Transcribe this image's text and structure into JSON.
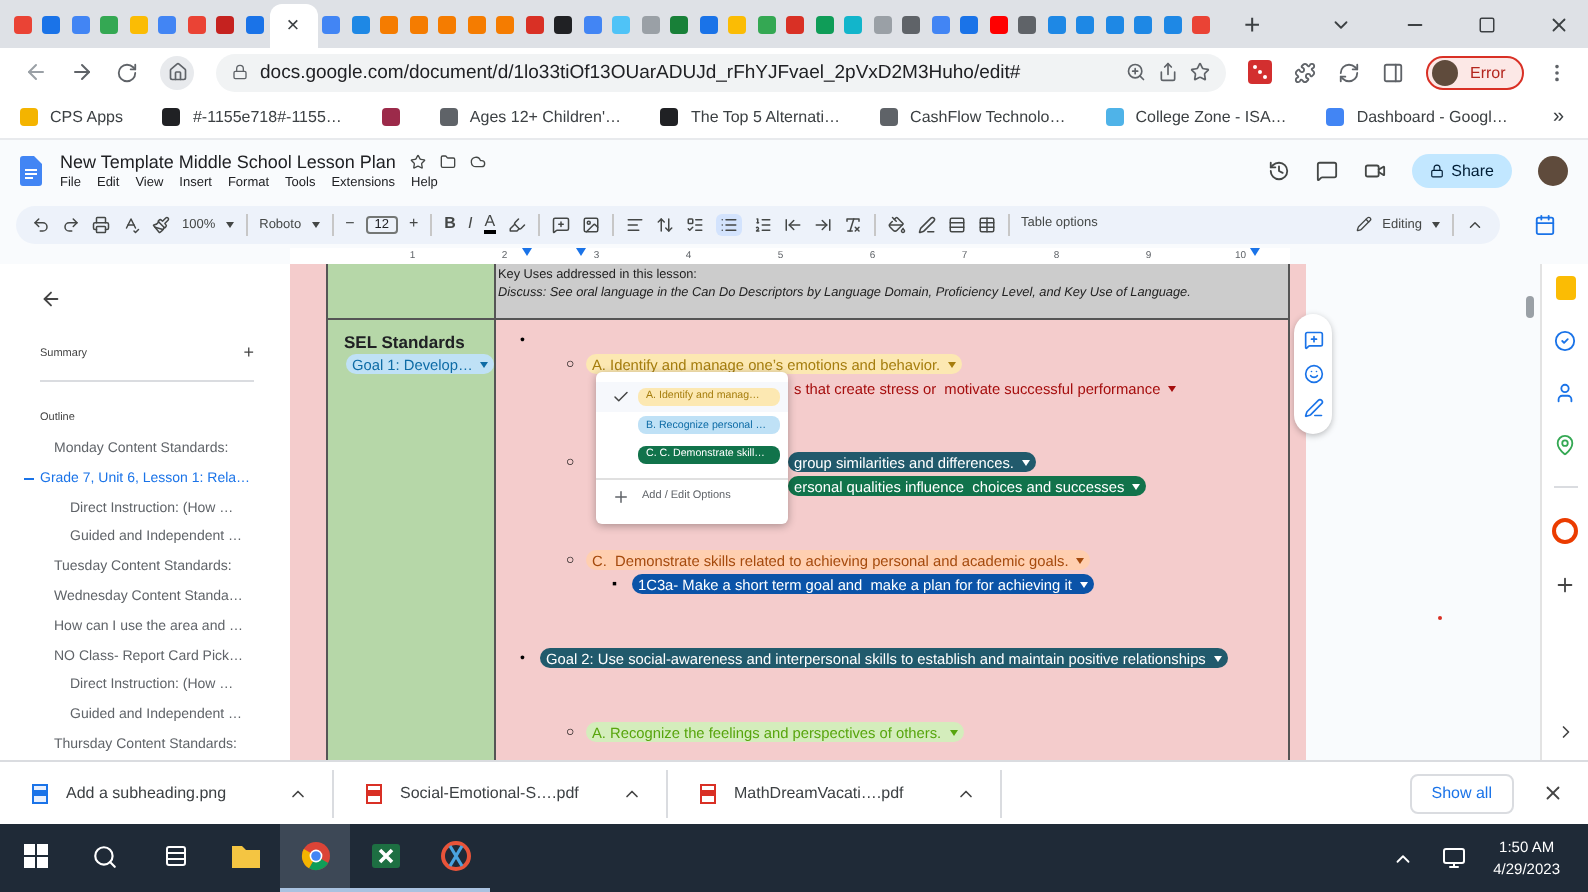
{
  "browser": {
    "tabs": [
      {
        "color": "#ea4335",
        "selected": false
      },
      {
        "color": "#1a73e8",
        "selected": false
      },
      {
        "color": "#4285f4",
        "selected": false
      },
      {
        "color": "#34a853",
        "selected": false
      },
      {
        "color": "#fbbc04",
        "selected": false
      },
      {
        "color": "#4285f4",
        "selected": false
      },
      {
        "color": "#ea4335",
        "selected": false
      },
      {
        "color": "#c5221f",
        "selected": false
      },
      {
        "color": "#1a73e8",
        "selected": false
      },
      {
        "selected": true
      },
      {
        "color": "#4285f4",
        "selected": false
      },
      {
        "color": "#1e88e5",
        "selected": false
      },
      {
        "color": "#f57c00",
        "selected": false
      },
      {
        "color": "#f57c00",
        "selected": false
      },
      {
        "color": "#f57c00",
        "selected": false
      },
      {
        "color": "#f57c00",
        "selected": false
      },
      {
        "color": "#f57c00",
        "selected": false
      },
      {
        "color": "#d93025",
        "selected": false
      },
      {
        "color": "#202124",
        "selected": false
      },
      {
        "color": "#4285f4",
        "selected": false
      },
      {
        "color": "#4fc3f7",
        "selected": false
      },
      {
        "color": "#9aa0a6",
        "selected": false
      },
      {
        "color": "#188038",
        "selected": false
      },
      {
        "color": "#1a73e8",
        "selected": false
      },
      {
        "color": "#fbbc04",
        "selected": false
      },
      {
        "color": "#34a853",
        "selected": false
      },
      {
        "color": "#d93025",
        "selected": false
      },
      {
        "color": "#0f9d58",
        "selected": false
      },
      {
        "color": "#12b5cb",
        "selected": false
      },
      {
        "color": "#9aa0a6",
        "selected": false
      },
      {
        "color": "#5f6368",
        "selected": false
      },
      {
        "color": "#4285f4",
        "selected": false
      },
      {
        "color": "#1a73e8",
        "selected": false
      },
      {
        "color": "#ff0000",
        "selected": false
      },
      {
        "color": "#5f6368",
        "selected": false
      },
      {
        "color": "#1e88e5",
        "selected": false
      },
      {
        "color": "#1e88e5",
        "selected": false
      },
      {
        "color": "#1e88e5",
        "selected": false
      },
      {
        "color": "#1e88e5",
        "selected": false
      },
      {
        "color": "#1e88e5",
        "selected": false
      },
      {
        "color": "#ea4335",
        "selected": false
      }
    ],
    "tab_close": "×",
    "new_tab": "+",
    "url": "docs.google.com/document/d/1lo33tiOf13OUarADUJd_rFhYJFvael_2pVxD2M3Huho/edit#",
    "profile_status": "Error",
    "bookmarks": [
      {
        "label": "CPS Apps",
        "color": "#f4b400"
      },
      {
        "label": "#-1155e718#-1155…",
        "color": "#202124"
      },
      {
        "color": "#9c2a4a"
      },
      {
        "label": "Ages 12+ Children'…",
        "color": "#5f6368"
      },
      {
        "label": "The Top 5 Alternati…",
        "color": "#202124"
      },
      {
        "label": "CashFlow Technolo…",
        "color": "#5f6368"
      },
      {
        "label": "College Zone - ISA…",
        "color": "#4fb3e8"
      },
      {
        "label": "Dashboard - Googl…",
        "color": "#4285f4"
      }
    ],
    "bookmarks_more": "»"
  },
  "doc": {
    "title": "New Template Middle School Lesson Plan",
    "menu": [
      "File",
      "Edit",
      "View",
      "Insert",
      "Format",
      "Tools",
      "Extensions",
      "Help"
    ],
    "share": "Share"
  },
  "toolbar": {
    "zoom": "100%",
    "font": "Roboto",
    "decrease": "−",
    "font_size": "12",
    "increase": "+",
    "bold": "B",
    "italic": "I",
    "text_color": "A",
    "bulleted_list_selected": true,
    "table_options": "Table options",
    "mode": "Editing"
  },
  "ruler": [
    "1",
    "2",
    "3",
    "4",
    "5",
    "6",
    "7",
    "8",
    "9",
    "10"
  ],
  "sidebar": {
    "summary": "Summary",
    "add": "+",
    "outline_title": "Outline",
    "outline": [
      {
        "text": "Monday Content Standards:",
        "selected": false
      },
      {
        "text": "Grade 7, Unit 6, Lesson 1: Rela…",
        "selected": true,
        "children": [
          {
            "text": "Direct Instruction: (How …",
            "selected": false
          },
          {
            "text": "Guided and Independent …",
            "selected": false
          }
        ]
      },
      {
        "text": "Tuesday Content Standards:",
        "selected": false
      },
      {
        "text": "Wednesday Content Standa…",
        "selected": false
      },
      {
        "text": "How can I use the area and …",
        "selected": false
      },
      {
        "text": "NO Class- Report Card Pick…",
        "selected": false,
        "children": [
          {
            "text": "Direct Instruction: (How …",
            "selected": false
          },
          {
            "text": "Guided and Independent …",
            "selected": false
          }
        ]
      },
      {
        "text": "Thursday Content Standards:",
        "selected": false
      }
    ]
  },
  "table": {
    "key_uses": "Key Uses addressed in this lesson:",
    "discuss": "Discuss: See oral language in the Can Do Descriptors by Language Domain, Proficiency Level, and Key Use of Language.",
    "standards_title": "SEL Standards",
    "goal_chip": {
      "text": "Goal 1: Develop…",
      "color": "#bfe1f6"
    },
    "goals": [
      {
        "marker": "•",
        "children": [
          {
            "marker": "○",
            "chip": {
              "text": "A. Identify and manage one’s emotions and behavior.",
              "color": "#fce8b2"
            },
            "children": [
              {
                "covered": true,
                "chip": {
                  "text": "s that create stress or  motivate successful performance",
                  "color": "#f4cccc"
                }
              }
            ]
          },
          {
            "marker": "○",
            "covered": true,
            "chip": {
              "text": "group similarities and differences.",
              "color": "#215a6c"
            },
            "children": [
              {
                "covered": true,
                "chip": {
                  "text": "ersonal qualities influence  choices and successes",
                  "color": "#11734b"
                }
              }
            ]
          },
          {
            "marker": "○",
            "chip": {
              "text": "C.  Demonstrate skills related to achieving personal and academic goals.",
              "color": "#ffcfb0"
            },
            "children": [
              {
                "marker": "▪",
                "chip": {
                  "text": "1C3a- Make a short term goal and  make a plan for for achieving it",
                  "color": "#0a53a8"
                }
              }
            ]
          }
        ]
      },
      {
        "marker": "•",
        "chip": {
          "text": "Goal 2: Use social-awareness and interpersonal skills to establish and maintain positive relationships",
          "color": "#215a6c"
        },
        "children": [
          {
            "marker": "○",
            "chip": {
              "text": "A. Recognize the feelings and perspectives of others.",
              "color": "#d4edbc"
            }
          }
        ]
      }
    ]
  },
  "dropdown": {
    "options": [
      {
        "text": "A. Identify and manag…",
        "color": "#fce8b2",
        "selected": true
      },
      {
        "text": "B. Recognize personal …",
        "color": "#bfe1f6",
        "selected": false
      },
      {
        "text": "C. C. Demonstrate skill…",
        "color": "#11734b",
        "selected": false
      }
    ],
    "add_label": "Add / Edit Options"
  },
  "downloads": {
    "files": [
      {
        "name": "Add a subheading.png",
        "kind": "image"
      },
      {
        "name": "Social-Emotional-S….pdf",
        "kind": "pdf"
      },
      {
        "name": "MathDreamVacati….pdf",
        "kind": "pdf"
      }
    ],
    "show_all": "Show all"
  },
  "taskbar": {
    "apps": [
      {
        "kind": "explorer",
        "selected": false,
        "running": false
      },
      {
        "kind": "chrome",
        "selected": true,
        "running": true
      },
      {
        "kind": "excel",
        "selected": false,
        "running": true
      },
      {
        "kind": "snipping",
        "selected": false,
        "running": true
      }
    ],
    "time": "1:50 AM",
    "date": "4/29/2023"
  }
}
